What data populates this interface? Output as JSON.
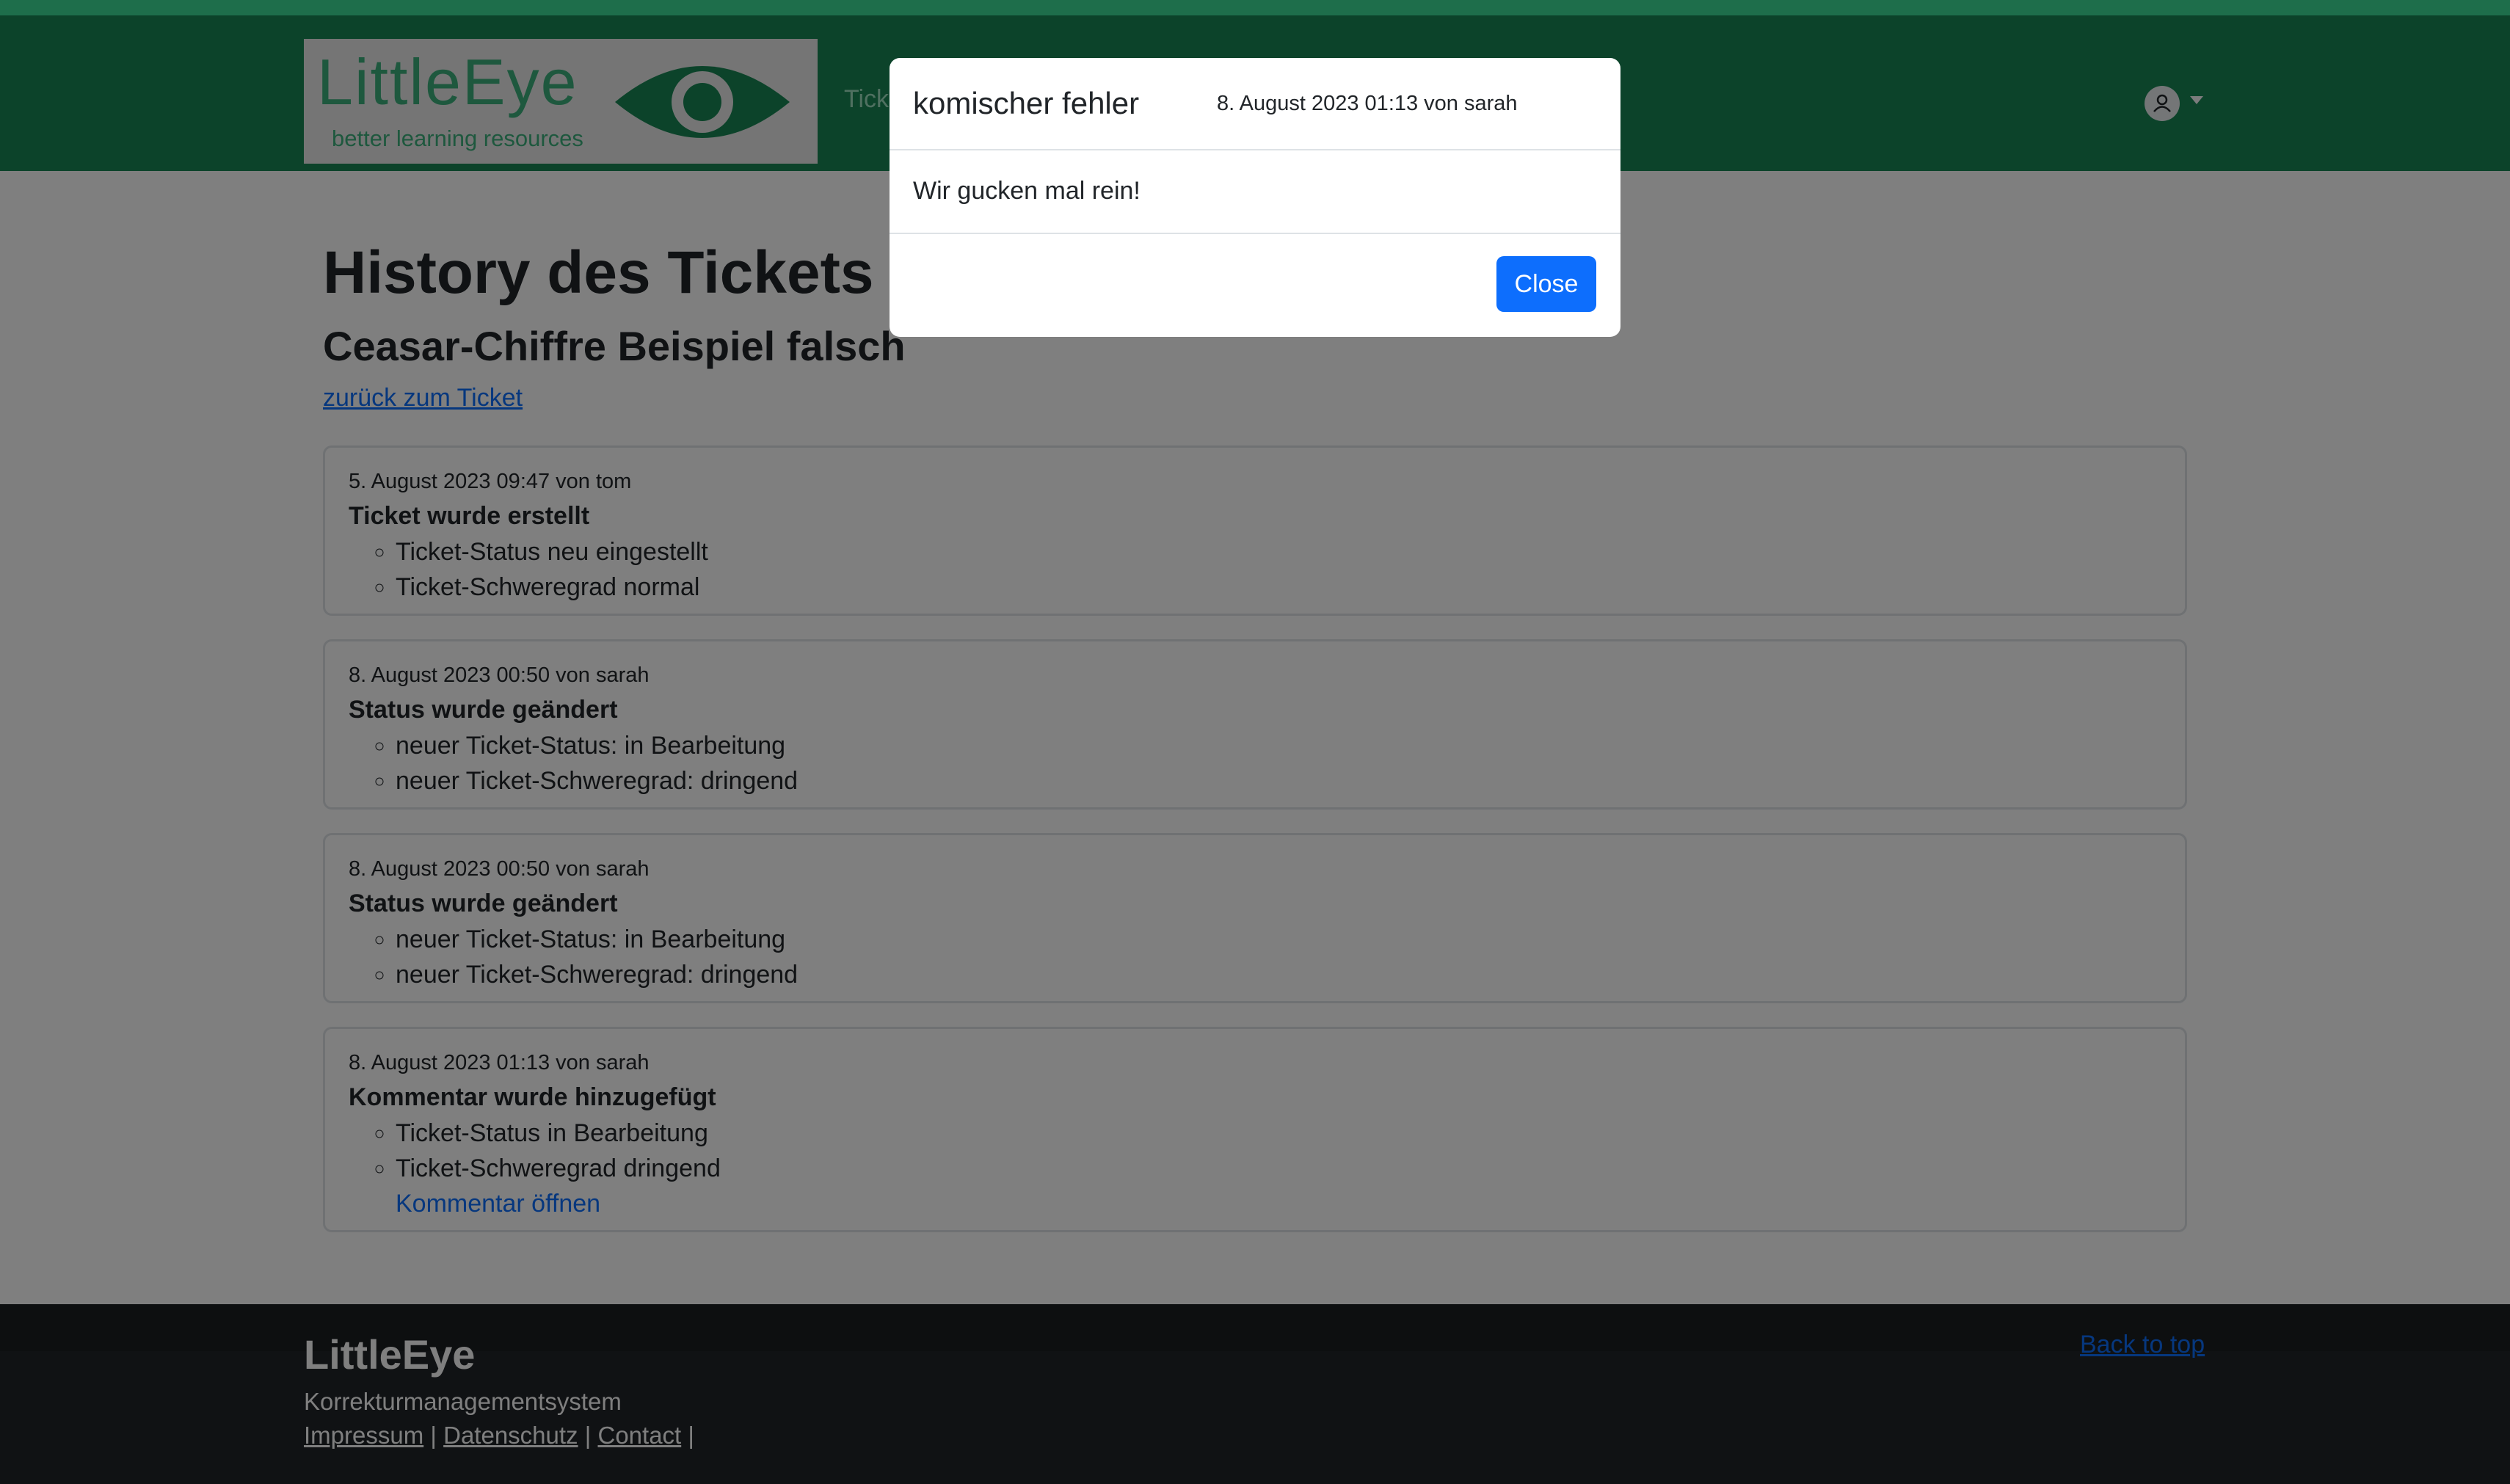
{
  "brand": {
    "logo_name": "LittleEye",
    "logo_tagline": "better learning resources"
  },
  "nav": {
    "partial_link": "Tick"
  },
  "page": {
    "title": "History des Tickets",
    "subtitle": "Ceasar-Chiffre Beispiel falsch",
    "back_link": "zurück zum Ticket"
  },
  "history": [
    {
      "meta": "5. August 2023 09:47 von tom",
      "title": "Ticket wurde erstellt",
      "items": [
        "Ticket-Status neu eingestellt",
        "Ticket-Schweregrad normal"
      ]
    },
    {
      "meta": "8. August 2023 00:50 von sarah",
      "title": "Status wurde geändert",
      "items": [
        "neuer Ticket-Status: in Bearbeitung",
        "neuer Ticket-Schweregrad: dringend"
      ]
    },
    {
      "meta": "8. August 2023 00:50 von sarah",
      "title": "Status wurde geändert",
      "items": [
        "neuer Ticket-Status: in Bearbeitung",
        "neuer Ticket-Schweregrad: dringend"
      ]
    },
    {
      "meta": "8. August 2023 01:13 von sarah",
      "title": "Kommentar wurde hinzugefügt",
      "items": [
        "Ticket-Status in Bearbeitung",
        "Ticket-Schweregrad dringend"
      ],
      "link": "Kommentar öffnen"
    }
  ],
  "modal": {
    "title": "komischer fehler",
    "meta": "8. August 2023 01:13 von sarah",
    "body": "Wir gucken mal rein!",
    "close_label": "Close"
  },
  "footer": {
    "brand": "LittleEye",
    "description": "Korrekturmanagementsystem",
    "links": [
      "Impressum",
      "Datenschutz",
      "Contact"
    ],
    "back_to_top": "Back to top"
  },
  "icons": {
    "logo": "eye-icon",
    "user": "user-icon",
    "user_menu": "caret-down-icon"
  },
  "colors": {
    "navbar": "#198754",
    "top_strip": "#3ddc97",
    "primary": "#0d6efd",
    "footer": "#212529",
    "backdrop": "rgba(0,0,0,0.5)"
  }
}
